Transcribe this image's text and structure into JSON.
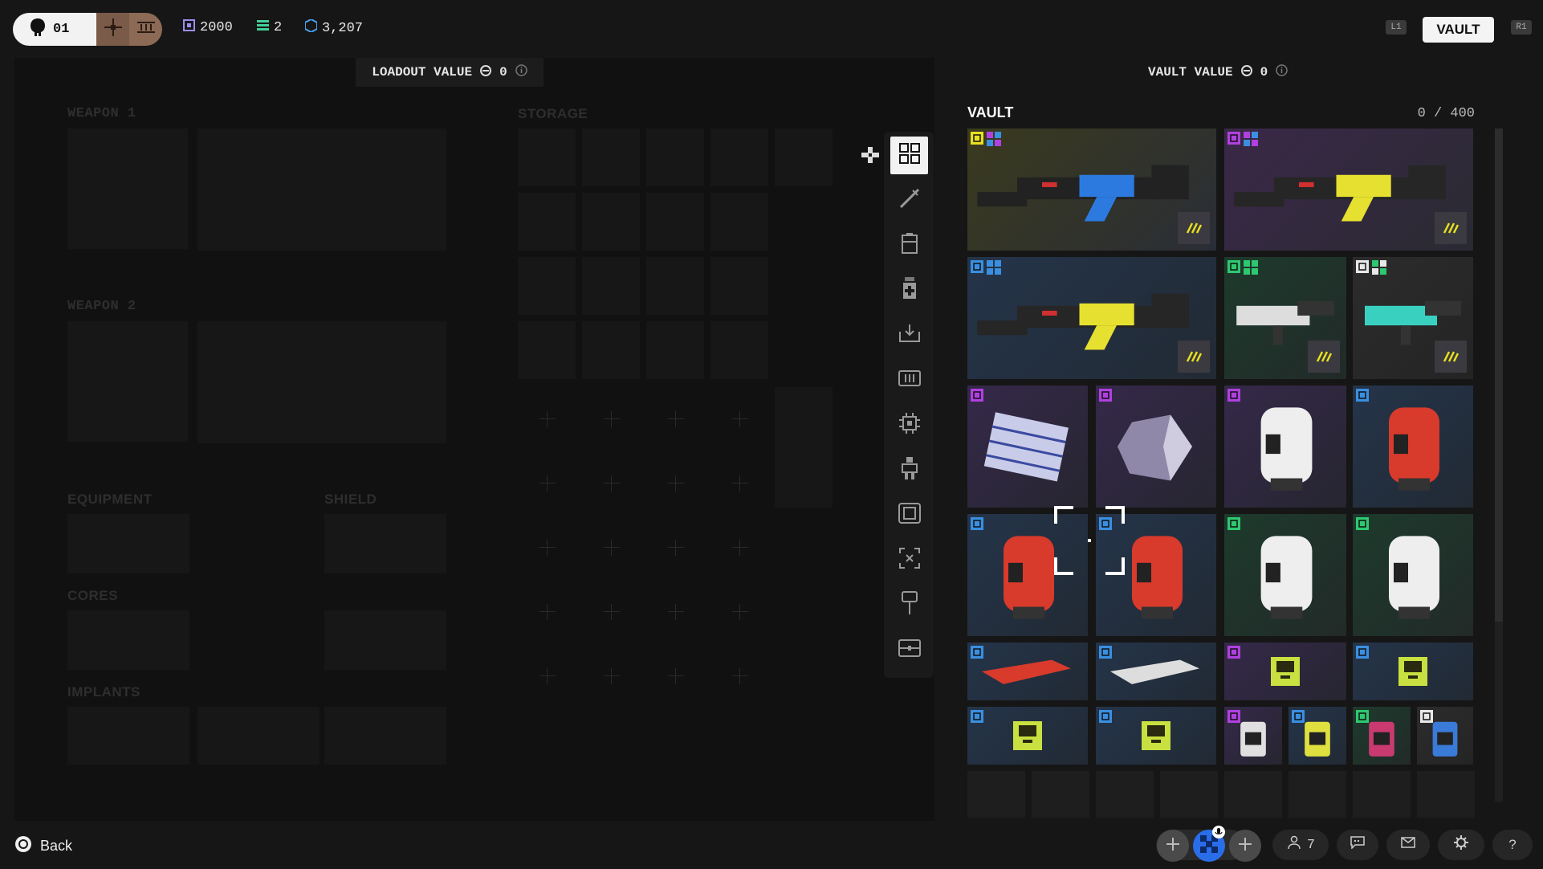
{
  "topbar": {
    "player_tag": "01",
    "stat_credits": "2000",
    "stat_layers": "2",
    "stat_currency": "3,207",
    "left_bumper": "L1",
    "right_bumper": "R1",
    "vault_label": "VAULT"
  },
  "loadout": {
    "value_label": "LOADOUT VALUE",
    "value": "0",
    "weapon1_label": "WEAPON 1",
    "weapon2_label": "WEAPON 2",
    "storage_label": "STORAGE",
    "equipment_label": "EQUIPMENT",
    "shield_label": "SHIELD",
    "cores_label": "CORES",
    "implants_label": "IMPLANTS"
  },
  "vault": {
    "value_label": "VAULT VALUE",
    "value": "0",
    "title": "VAULT",
    "count": "0 / 400"
  },
  "rail": {
    "icons": [
      "all-grid-icon",
      "weapon-icon",
      "backpack-icon",
      "consumable-icon",
      "equipment-icon",
      "ammo-icon",
      "core-chip-icon",
      "implant-icon",
      "shield-core-icon",
      "salvage-icon",
      "key-icon",
      "container-icon"
    ],
    "selected": "all-grid-icon"
  },
  "colors": {
    "accent_yellow": "#e8e020",
    "rarity_purple": "#b040e0",
    "rarity_blue": "#3a8fe0",
    "rarity_green": "#2ec870",
    "vault_button_bg": "#f4f4f4"
  },
  "bottombar": {
    "back_label": "Back",
    "squad_count": "7"
  }
}
